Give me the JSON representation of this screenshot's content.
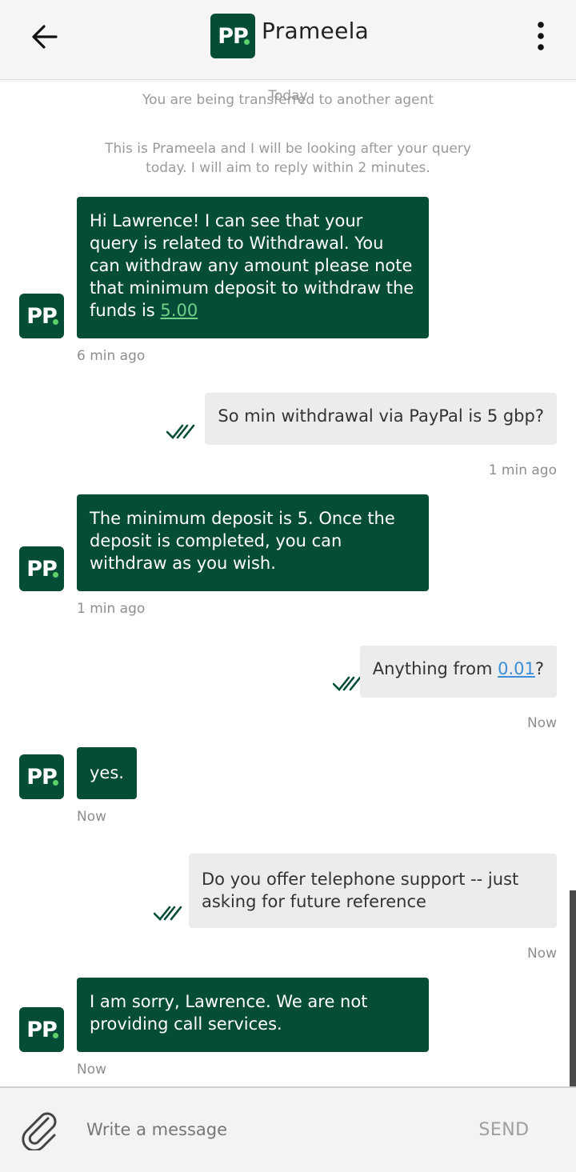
{
  "header": {
    "title": "Prameela",
    "logo_text": "PP",
    "back_icon": "arrow-left-icon",
    "menu_icon": "more-vertical-icon"
  },
  "colors": {
    "brand": "#064d38",
    "accent_dot": "#5cd16a",
    "user_bubble": "#ececec"
  },
  "system": {
    "today": "Today",
    "transfer": "You are being transferred to another agent",
    "intro": "This is Prameela and I will be looking after your query today. I will aim to reply within 2 minutes."
  },
  "messages": [
    {
      "from": "agent",
      "text_before": "Hi Lawrence! I can see that your query is related to Withdrawal. You can withdraw any amount please note that minimum deposit to withdraw the funds is ",
      "link": "5.00",
      "text_after": "",
      "time": "6 min ago"
    },
    {
      "from": "user",
      "text": "So min withdrawal via PayPal is 5 gbp?",
      "time": "1 min ago"
    },
    {
      "from": "agent",
      "text": "The minimum deposit is 5. Once the deposit is completed, you can withdraw as you wish.",
      "time": "1 min ago"
    },
    {
      "from": "user",
      "text_before": "Anything from ",
      "link": "0.01",
      "text_after": "?",
      "time": "Now"
    },
    {
      "from": "agent",
      "text": "yes.",
      "time": "Now"
    },
    {
      "from": "user",
      "text": "Do you offer telephone support -- just asking for future reference",
      "time": "Now"
    },
    {
      "from": "agent",
      "text": "I am sorry, Lawrence. We are not providing call services.",
      "time": "Now"
    }
  ],
  "composer": {
    "placeholder": "Write a message",
    "send_label": "SEND",
    "attach_icon": "paperclip-icon"
  }
}
